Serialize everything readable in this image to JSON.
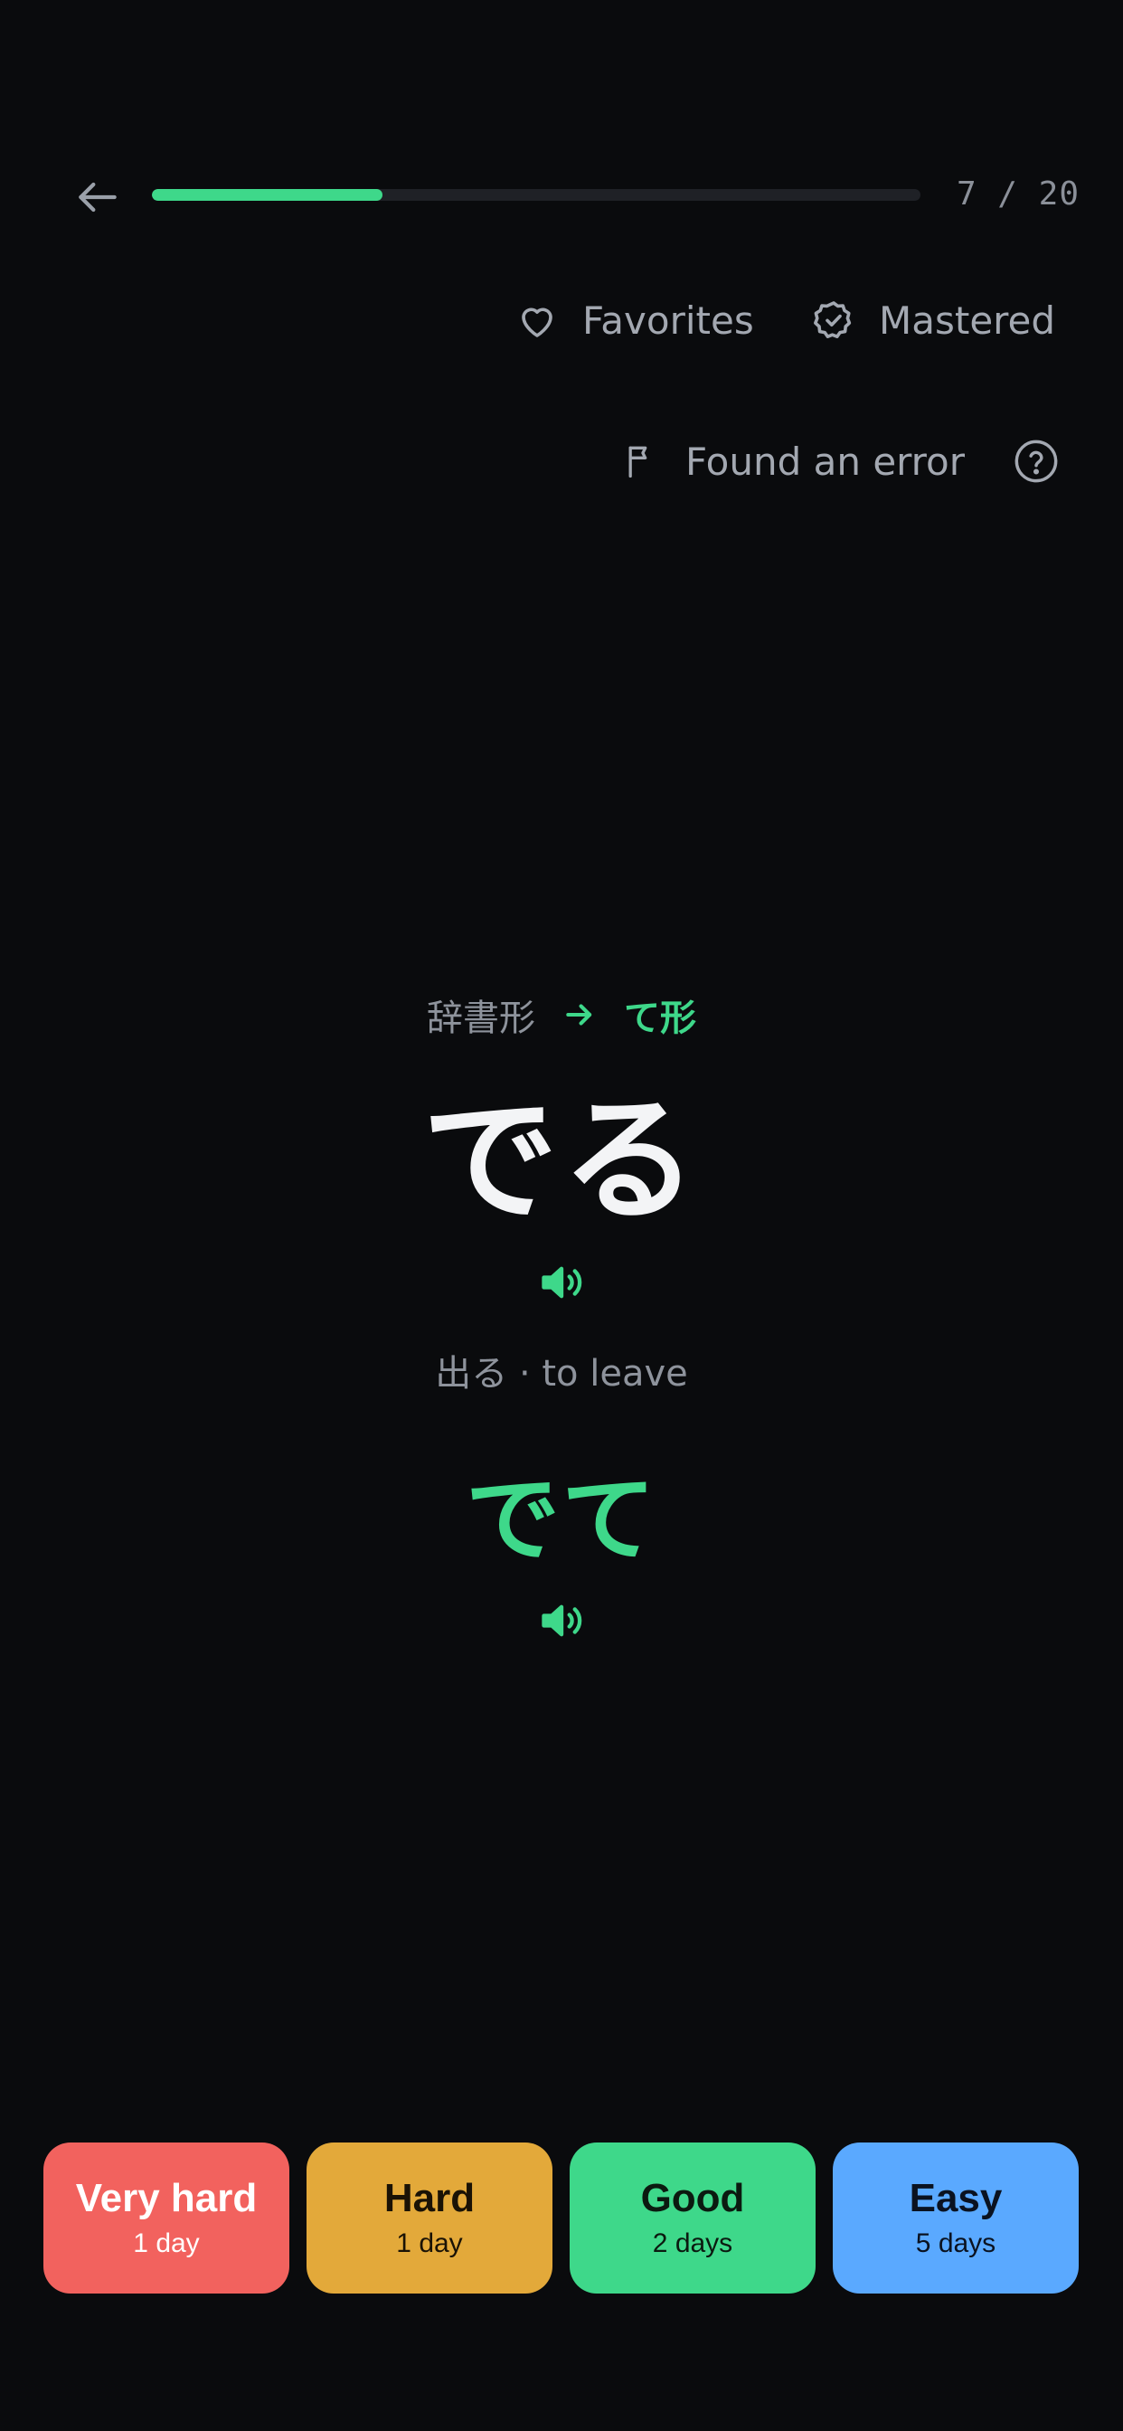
{
  "header": {
    "progress": {
      "current": 7,
      "total": 20,
      "fraction": 0.3,
      "text": "7 / 20"
    }
  },
  "actions": {
    "favorites_label": "Favorites",
    "mastered_label": "Mastered",
    "error_label": "Found an error"
  },
  "card": {
    "form_from": "辞書形",
    "form_to": "て形",
    "word": "でる",
    "meaning": "出る · to leave",
    "answer": "でて"
  },
  "ratings": [
    {
      "label": "Very hard",
      "interval": "1 day",
      "color": "#f2625e",
      "text_color": "#ffffff"
    },
    {
      "label": "Hard",
      "interval": "1 day",
      "color": "#e3a93a",
      "text_color": "#1a1205"
    },
    {
      "label": "Good",
      "interval": "2 days",
      "color": "#3ed88a",
      "text_color": "#0b1a10"
    },
    {
      "label": "Easy",
      "interval": "5 days",
      "color": "#5aa9ff",
      "text_color": "#0a1220"
    }
  ],
  "icons": {
    "back": "arrow-left-icon",
    "favorites": "heart-icon",
    "mastered": "badge-check-icon",
    "error": "flag-icon",
    "help": "question-circle-icon",
    "form_arrow": "arrow-right-icon",
    "speaker": "speaker-icon"
  },
  "colors": {
    "background": "#0a0b0d",
    "accent": "#3ed88a",
    "progress_track": "#1f2126",
    "muted_text": "#8e939c"
  }
}
